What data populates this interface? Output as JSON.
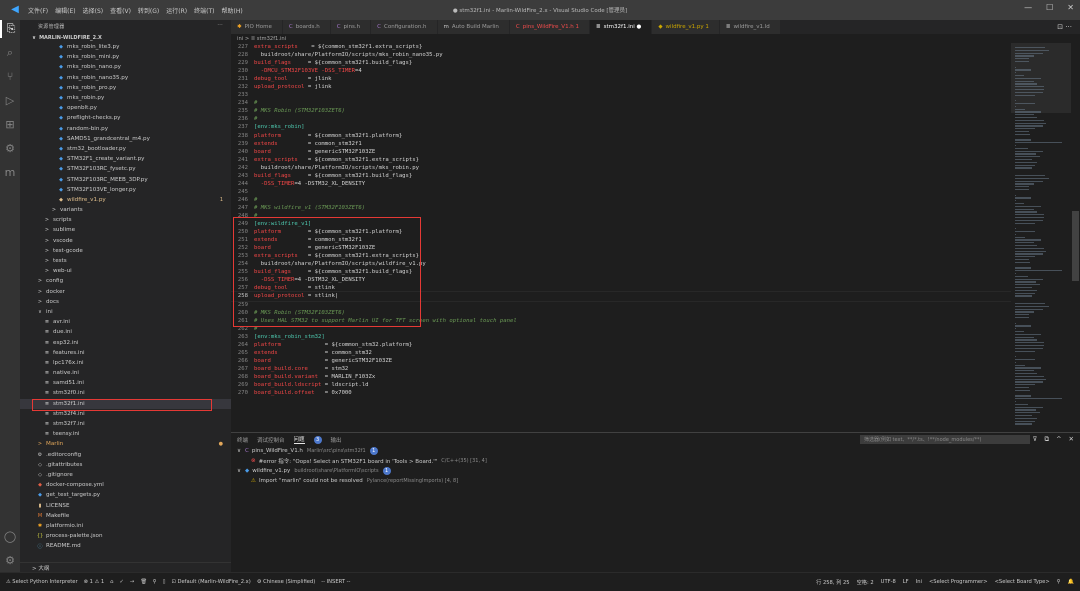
{
  "window": {
    "title": "● stm32f1.ini - Marlin-WildFire_2.x - Visual Studio Code [管理员]",
    "menu": [
      "文件(F)",
      "编辑(E)",
      "选择(S)",
      "查看(V)",
      "转到(G)",
      "运行(R)",
      "终端(T)",
      "帮助(H)"
    ],
    "controls": [
      "—",
      "☐",
      "✕"
    ]
  },
  "activity": [
    "⎘",
    "⌕",
    "⑂",
    "▷",
    "⊞",
    "⚙",
    "m"
  ],
  "activity_bottom": [
    "◯",
    "⚙"
  ],
  "sidebar": {
    "header": "资源管理器",
    "more": "···",
    "root": "MARLIN-WILDFIRE_2.X",
    "outline": "> 大纲",
    "items": [
      {
        "label": "mks_robin_lite3.py",
        "icon": "◆",
        "kind": "py",
        "indent": 3
      },
      {
        "label": "mks_robin_mini.py",
        "icon": "◆",
        "kind": "py",
        "indent": 3
      },
      {
        "label": "mks_robin_nano.py",
        "icon": "◆",
        "kind": "py",
        "indent": 3
      },
      {
        "label": "mks_robin_nano35.py",
        "icon": "◆",
        "kind": "py",
        "indent": 3
      },
      {
        "label": "mks_robin_pro.py",
        "icon": "◆",
        "kind": "py",
        "indent": 3
      },
      {
        "label": "mks_robin.py",
        "icon": "◆",
        "kind": "py",
        "indent": 3
      },
      {
        "label": "openblt.py",
        "icon": "◆",
        "kind": "py",
        "indent": 3
      },
      {
        "label": "preflight-checks.py",
        "icon": "◆",
        "kind": "py",
        "indent": 3
      },
      {
        "label": "random-bin.py",
        "icon": "◆",
        "kind": "py",
        "indent": 3
      },
      {
        "label": "SAMD51_grandcentral_m4.py",
        "icon": "◆",
        "kind": "py",
        "indent": 3
      },
      {
        "label": "stm32_bootloader.py",
        "icon": "◆",
        "kind": "py",
        "indent": 3
      },
      {
        "label": "STM32F1_create_variant.py",
        "icon": "◆",
        "kind": "py",
        "indent": 3
      },
      {
        "label": "STM32F103RC_fysetc.py",
        "icon": "◆",
        "kind": "py",
        "indent": 3
      },
      {
        "label": "STM32F103RC_MEEB_3DP.py",
        "icon": "◆",
        "kind": "py",
        "indent": 3
      },
      {
        "label": "STM32F103VE_longer.py",
        "icon": "◆",
        "kind": "py",
        "indent": 3
      },
      {
        "label": "wildfire_v1.py",
        "icon": "◆",
        "kind": "py-mod",
        "indent": 3,
        "badge": "1"
      },
      {
        "label": "variants",
        "icon": ">",
        "kind": "folder",
        "indent": 2
      },
      {
        "label": "scripts",
        "icon": ">",
        "kind": "folder",
        "indent": 1
      },
      {
        "label": "sublime",
        "icon": ">",
        "kind": "folder",
        "indent": 1
      },
      {
        "label": "vscode",
        "icon": ">",
        "kind": "folder",
        "indent": 1
      },
      {
        "label": "test-gcode",
        "icon": ">",
        "kind": "folder",
        "indent": 1
      },
      {
        "label": "tests",
        "icon": ">",
        "kind": "folder",
        "indent": 1
      },
      {
        "label": "web-ui",
        "icon": ">",
        "kind": "folder",
        "indent": 1
      },
      {
        "label": "config",
        "icon": ">",
        "kind": "folder",
        "indent": 0
      },
      {
        "label": "docker",
        "icon": ">",
        "kind": "folder",
        "indent": 0
      },
      {
        "label": "docs",
        "icon": ">",
        "kind": "folder",
        "indent": 0
      },
      {
        "label": "ini",
        "icon": "∨",
        "kind": "folder",
        "indent": 0
      },
      {
        "label": "avr.ini",
        "icon": "≣",
        "kind": "ini",
        "indent": 1
      },
      {
        "label": "due.ini",
        "icon": "≣",
        "kind": "ini",
        "indent": 1
      },
      {
        "label": "esp32.ini",
        "icon": "≣",
        "kind": "ini",
        "indent": 1
      },
      {
        "label": "features.ini",
        "icon": "≣",
        "kind": "ini",
        "indent": 1
      },
      {
        "label": "lpc176x.ini",
        "icon": "≣",
        "kind": "ini",
        "indent": 1
      },
      {
        "label": "native.ini",
        "icon": "≣",
        "kind": "ini",
        "indent": 1
      },
      {
        "label": "samd51.ini",
        "icon": "≣",
        "kind": "ini",
        "indent": 1
      },
      {
        "label": "stm32f0.ini",
        "icon": "≣",
        "kind": "ini",
        "indent": 1
      },
      {
        "label": "stm32f1.ini",
        "icon": "≣",
        "kind": "ini",
        "indent": 1,
        "selected": true
      },
      {
        "label": "stm32f4.ini",
        "icon": "≣",
        "kind": "ini",
        "indent": 1
      },
      {
        "label": "stm32f7.ini",
        "icon": "≣",
        "kind": "ini",
        "indent": 1
      },
      {
        "label": "teensy.ini",
        "icon": "≣",
        "kind": "ini",
        "indent": 1
      },
      {
        "label": "Marlin",
        "icon": ">",
        "kind": "folder-mod",
        "indent": 0,
        "badge": "●"
      },
      {
        "label": ".editorconfig",
        "icon": "⚙",
        "kind": "ini",
        "indent": 0
      },
      {
        "label": ".gitattributes",
        "icon": "◇",
        "kind": "ini",
        "indent": 0
      },
      {
        "label": ".gitignore",
        "icon": "◇",
        "kind": "ini",
        "indent": 0
      },
      {
        "label": "docker-compose.yml",
        "icon": "◆",
        "kind": "docker",
        "indent": 0
      },
      {
        "label": "get_test_targets.py",
        "icon": "◆",
        "kind": "py",
        "indent": 0
      },
      {
        "label": "LICENSE",
        "icon": "▮",
        "kind": "license",
        "indent": 0
      },
      {
        "label": "Makefile",
        "icon": "M",
        "kind": "make",
        "indent": 0
      },
      {
        "label": "platformio.ini",
        "icon": "✱",
        "kind": "pio",
        "indent": 0
      },
      {
        "label": "process-palette.json",
        "icon": "{}",
        "kind": "json",
        "indent": 0
      },
      {
        "label": "README.md",
        "icon": "ⓘ",
        "kind": "md",
        "indent": 0
      }
    ]
  },
  "tabs": [
    {
      "label": "PIO Home",
      "icon": "✱",
      "color": "#f5a623"
    },
    {
      "label": "boards.h",
      "icon": "C",
      "color": "#a074c4"
    },
    {
      "label": "pins.h",
      "icon": "C",
      "color": "#a074c4"
    },
    {
      "label": "Configuration.h",
      "icon": "C",
      "color": "#a074c4"
    },
    {
      "label": "Auto Build Marlin",
      "icon": "m",
      "color": "#cccccc"
    },
    {
      "label": "pins_WildFire_V1.h 1",
      "icon": "C",
      "color": "#f14c4c"
    },
    {
      "label": "stm32f1.ini ●",
      "icon": "≣",
      "color": "#ffffff",
      "active": true
    },
    {
      "label": "wildfire_v1.py 1",
      "icon": "◆",
      "color": "#cca700"
    },
    {
      "label": "wildfire_v1.ld",
      "icon": "≣",
      "color": "#cccccc"
    }
  ],
  "tab_controls": "⊡ ···",
  "breadcrumb": "ini  >  ≣ stm32f1.ini",
  "code": [
    {
      "n": "227",
      "t": [
        [
          "kk",
          "extra_scripts"
        ],
        [
          "pl",
          "    = ${common_stm32f1.extra_scripts}"
        ]
      ]
    },
    {
      "n": "228",
      "t": [
        [
          "pl",
          "  buildroot/share/PlatformIO/scripts/mks_robin_nano35.py"
        ]
      ]
    },
    {
      "n": "229",
      "t": [
        [
          "kk",
          "build_flags"
        ],
        [
          "pl",
          "     = ${common_stm32f1.build_flags}"
        ]
      ]
    },
    {
      "n": "230",
      "t": [
        [
          "pl",
          "  "
        ],
        [
          "kk",
          "-DMCU_STM32F103VE -DSS_TIMER"
        ],
        [
          "pl",
          "=4"
        ]
      ]
    },
    {
      "n": "231",
      "t": [
        [
          "kk",
          "debug_tool"
        ],
        [
          "pl",
          "      = jlink"
        ]
      ]
    },
    {
      "n": "232",
      "t": [
        [
          "kk",
          "upload_protocol"
        ],
        [
          "pl",
          " = jlink"
        ]
      ]
    },
    {
      "n": "233",
      "t": [
        [
          "pl",
          ""
        ]
      ]
    },
    {
      "n": "234",
      "t": [
        [
          "cm",
          "#"
        ]
      ]
    },
    {
      "n": "235",
      "t": [
        [
          "cm",
          "# MKS Robin (STM32F103ZET6)"
        ]
      ]
    },
    {
      "n": "236",
      "t": [
        [
          "cm",
          "#"
        ]
      ]
    },
    {
      "n": "237",
      "t": [
        [
          "sec",
          "[env:mks_robin]"
        ]
      ]
    },
    {
      "n": "238",
      "t": [
        [
          "kk",
          "platform"
        ],
        [
          "pl",
          "        = ${common_stm32f1.platform}"
        ]
      ]
    },
    {
      "n": "239",
      "t": [
        [
          "kk",
          "extends"
        ],
        [
          "pl",
          "         = common_stm32f1"
        ]
      ]
    },
    {
      "n": "240",
      "t": [
        [
          "kk",
          "board"
        ],
        [
          "pl",
          "           = genericSTM32F103ZE"
        ]
      ]
    },
    {
      "n": "241",
      "t": [
        [
          "kk",
          "extra_scripts"
        ],
        [
          "pl",
          "   = ${common_stm32f1.extra_scripts}"
        ]
      ]
    },
    {
      "n": "242",
      "t": [
        [
          "pl",
          "  buildroot/share/PlatformIO/scripts/mks_robin.py"
        ]
      ]
    },
    {
      "n": "243",
      "t": [
        [
          "kk",
          "build_flags"
        ],
        [
          "pl",
          "     = ${common_stm32f1.build_flags}"
        ]
      ]
    },
    {
      "n": "244",
      "t": [
        [
          "pl",
          "  "
        ],
        [
          "kk",
          "-DSS_TIMER"
        ],
        [
          "pl",
          "=4 -DSTM32_XL_DENSITY"
        ]
      ]
    },
    {
      "n": "245",
      "t": [
        [
          "pl",
          ""
        ]
      ]
    },
    {
      "n": "246",
      "t": [
        [
          "cm",
          "#"
        ]
      ]
    },
    {
      "n": "247",
      "t": [
        [
          "cm",
          "# MKS wildfire_v1 (STM32F103ZET6)"
        ]
      ]
    },
    {
      "n": "248",
      "t": [
        [
          "cm",
          "#"
        ]
      ]
    },
    {
      "n": "249",
      "t": [
        [
          "sec",
          "[env:wildfire_v1]"
        ]
      ]
    },
    {
      "n": "250",
      "t": [
        [
          "kk",
          "platform"
        ],
        [
          "pl",
          "        = ${common_stm32f1.platform}"
        ]
      ]
    },
    {
      "n": "251",
      "t": [
        [
          "kk",
          "extends"
        ],
        [
          "pl",
          "         = common_stm32f1"
        ]
      ]
    },
    {
      "n": "252",
      "t": [
        [
          "kk",
          "board"
        ],
        [
          "pl",
          "           = genericSTM32F103ZE"
        ]
      ]
    },
    {
      "n": "253",
      "t": [
        [
          "kk",
          "extra_scripts"
        ],
        [
          "pl",
          "   = ${common_stm32f1.extra_scripts}"
        ]
      ]
    },
    {
      "n": "254",
      "t": [
        [
          "pl",
          "  buildroot/share/PlatformIO/scripts/wildfire_v1.py"
        ]
      ]
    },
    {
      "n": "255",
      "t": [
        [
          "kk",
          "build_flags"
        ],
        [
          "pl",
          "     = ${common_stm32f1.build_flags}"
        ]
      ]
    },
    {
      "n": "256",
      "t": [
        [
          "pl",
          "  "
        ],
        [
          "kk",
          "-DSS_TIMER"
        ],
        [
          "pl",
          "=4 -DSTM32_XL_DENSITY"
        ]
      ]
    },
    {
      "n": "257",
      "t": [
        [
          "kk",
          "debug_tool"
        ],
        [
          "pl",
          "      = stlink"
        ]
      ]
    },
    {
      "n": "258",
      "t": [
        [
          "kk",
          "upload_protocol"
        ],
        [
          "pl",
          " = stlink|"
        ]
      ],
      "current": true
    },
    {
      "n": "259",
      "t": [
        [
          "pl",
          ""
        ]
      ]
    },
    {
      "n": "260",
      "t": [
        [
          "cm",
          "# MKS Robin (STM32F103ZET6)"
        ]
      ]
    },
    {
      "n": "261",
      "t": [
        [
          "cm",
          "# Uses HAL STM32 to support Marlin UI for TFT screen with optional touch panel"
        ]
      ]
    },
    {
      "n": "262",
      "t": [
        [
          "cm",
          "#"
        ]
      ]
    },
    {
      "n": "263",
      "t": [
        [
          "sec",
          "[env:mks_robin_stm32]"
        ]
      ]
    },
    {
      "n": "264",
      "t": [
        [
          "kk",
          "platform"
        ],
        [
          "pl",
          "             = ${common_stm32.platform}"
        ]
      ]
    },
    {
      "n": "265",
      "t": [
        [
          "kk",
          "extends"
        ],
        [
          "pl",
          "              = common_stm32"
        ]
      ]
    },
    {
      "n": "266",
      "t": [
        [
          "kk",
          "board"
        ],
        [
          "pl",
          "                = genericSTM32F103ZE"
        ]
      ]
    },
    {
      "n": "267",
      "t": [
        [
          "kk",
          "board_build.core"
        ],
        [
          "pl",
          "     = stm32"
        ]
      ]
    },
    {
      "n": "268",
      "t": [
        [
          "kk",
          "board_build.variant"
        ],
        [
          "pl",
          "  = MARLIN_F103Zx"
        ]
      ]
    },
    {
      "n": "269",
      "t": [
        [
          "kk",
          "board_build.ldscript"
        ],
        [
          "pl",
          " = ldscript.ld"
        ]
      ]
    },
    {
      "n": "270",
      "t": [
        [
          "kk",
          "board_build.offset"
        ],
        [
          "pl",
          "   = 0x7000"
        ]
      ]
    }
  ],
  "panel": {
    "tabs": [
      "终端",
      "调试控制台",
      "问题",
      "输出"
    ],
    "active_tab": "问题",
    "problem_count": "3",
    "filter_placeholder": "筛选器(例如 text、**/*.ts、!**/node_modules/**)",
    "controls": [
      "⊽",
      "⧉",
      "^",
      "✕"
    ],
    "groups": [
      {
        "file": "pins_WildFire_V1.h",
        "path": "Marlin\\src\\pins\\stm32f1",
        "count": "1",
        "icon": "C",
        "icon_color": "#a074c4",
        "rows": [
          {
            "severity": "error",
            "text": "#error 指令: \"Oops! Select an STM32F1 board in 'Tools > Board.'\"",
            "src": "C/C++(35) [31, 4]"
          }
        ]
      },
      {
        "file": "wildfire_v1.py",
        "path": "buildroot\\share\\PlatformIO\\scripts",
        "count": "1",
        "icon": "◆",
        "icon_color": "#4a9be8",
        "rows": [
          {
            "severity": "warning",
            "text": "Import \"marlin\" could not be resolved",
            "src": "Pylance(reportMissingImports) [4, 8]"
          }
        ]
      }
    ]
  },
  "status": {
    "left": [
      "⚠ Select Python Interpreter",
      "⊗ 1 ⚠ 1",
      "⌂",
      "✓",
      "→",
      "🗑",
      "⚲",
      "▯",
      "⊡ Default (Marlin-WildFire_2.x)",
      "⚙ Chinese (Simplified)",
      "-- INSERT --"
    ],
    "right": [
      "行 258, 列 25",
      "空格: 2",
      "UTF-8",
      "LF",
      "Ini",
      "<Select Programmer>",
      "<Select Board Type>",
      "⚲",
      "🔔"
    ]
  },
  "colors": {
    "accent": "#007acc",
    "error": "#f14c4c",
    "warning": "#cca700",
    "highlight_box": "#e53935"
  }
}
